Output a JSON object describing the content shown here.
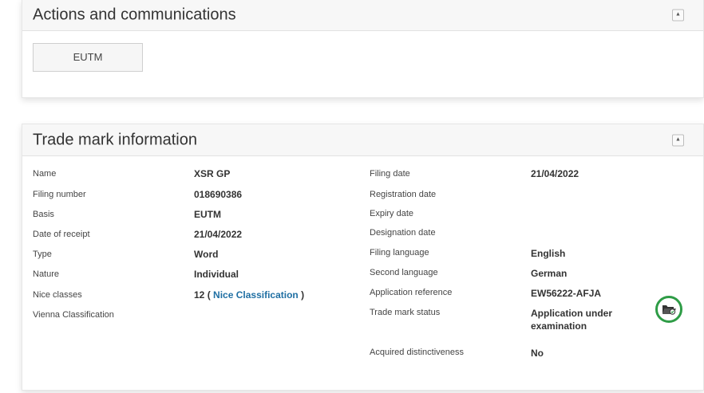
{
  "actions_panel": {
    "title": "Actions and communications",
    "collapse_symbol": "▲",
    "eutm_button": "EUTM"
  },
  "trade_mark_panel": {
    "title": "Trade mark information",
    "collapse_symbol": "▲",
    "left_fields": [
      {
        "label": "Name",
        "value": "XSR GP"
      },
      {
        "label": "Filing number",
        "value": "018690386"
      },
      {
        "label": "Basis",
        "value": "EUTM"
      },
      {
        "label": "Date of receipt",
        "value": "21/04/2022"
      },
      {
        "label": "Type",
        "value": "Word"
      },
      {
        "label": "Nature",
        "value": "Individual"
      },
      {
        "label": "Nice classes",
        "value": "12",
        "link_open": "(",
        "link_text": "Nice Classification",
        "link_close": ")"
      },
      {
        "label": "Vienna Classification",
        "value": ""
      }
    ],
    "right_fields": [
      {
        "label": "Filing date",
        "value": "21/04/2022"
      },
      {
        "label": "Registration date",
        "value": ""
      },
      {
        "label": "Expiry date",
        "value": ""
      },
      {
        "label": "Designation date",
        "value": ""
      },
      {
        "label": "Filing language",
        "value": "English"
      },
      {
        "label": "Second language",
        "value": "German"
      },
      {
        "label": "Application reference",
        "value": "EW56222-AFJA"
      },
      {
        "label": "Trade mark status",
        "value": "Application under examination"
      },
      {
        "label": "Acquired distinctiveness",
        "value": "No"
      }
    ],
    "status_icon": "folder-open-icon",
    "status_icon_color": "#2e9c46",
    "link_color": "#1f6fa3"
  }
}
